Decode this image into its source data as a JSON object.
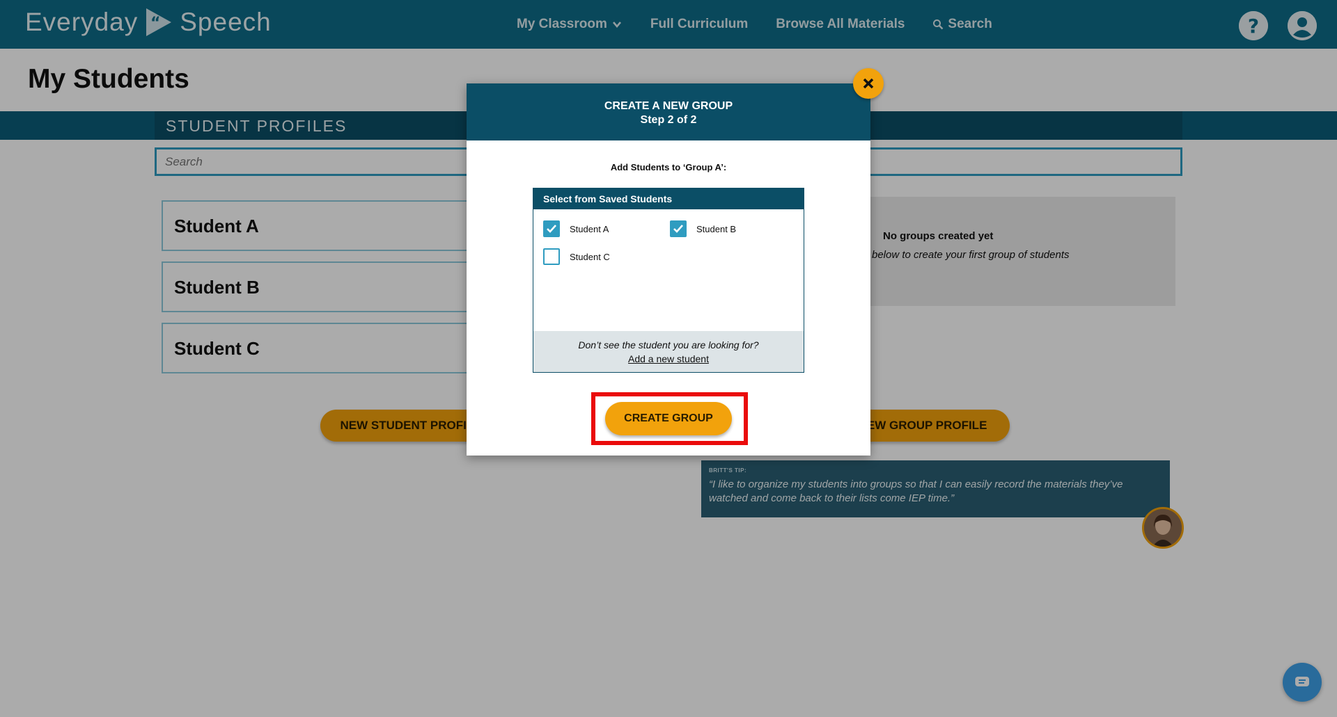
{
  "header": {
    "logo_left": "Everyday",
    "logo_right": "Speech",
    "nav": [
      {
        "label": "My Classroom",
        "icon": "chevron-down-icon"
      },
      {
        "label": "Full Curriculum"
      },
      {
        "label": "Browse All Materials"
      },
      {
        "label": "Search",
        "icon": "search-icon"
      }
    ],
    "help_icon": "help-icon",
    "account_icon": "account-icon"
  },
  "page": {
    "title": "My Students",
    "section_label": "STUDENT PROFILES",
    "search_placeholder": "Search",
    "students": [
      "Student A",
      "Student B",
      "Student C"
    ],
    "groups_empty_title": "No groups created yet",
    "groups_empty_sub": "below to create your first group of students",
    "new_student_button": "NEW STUDENT PROFILE",
    "new_group_button": "NEW GROUP PROFILE",
    "tip_label": "BRITT'S TIP:",
    "tip_text": "“I like to organize my students into groups so that I can easily record the materials they’ve watched and come back to their lists come IEP time.”"
  },
  "modal": {
    "title": "CREATE A NEW GROUP",
    "step": "Step 2 of 2",
    "instruction": "Add Students to ‘Group A’:",
    "picker_title": "Select from Saved Students",
    "options": [
      {
        "label": "Student A",
        "checked": true
      },
      {
        "label": "Student B",
        "checked": true
      },
      {
        "label": "Student C",
        "checked": false
      }
    ],
    "footer_question": "Don’t see the student you are looking for?",
    "footer_link": "Add a new student",
    "create_button": "CREATE GROUP"
  },
  "colors": {
    "header_bg": "#0e6c88",
    "accent_orange": "#f2a20c",
    "modal_header": "#0b4e66",
    "checkbox": "#2f9cc0",
    "highlight": "#ea0b0b"
  }
}
